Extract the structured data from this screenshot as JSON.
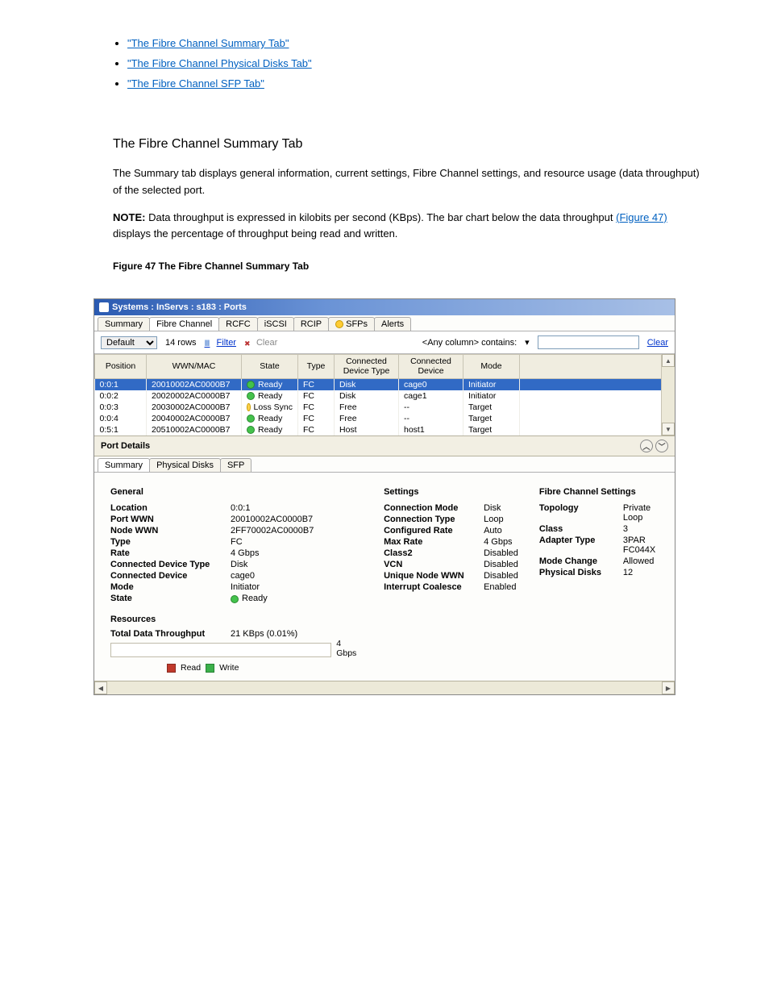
{
  "doc": {
    "links": [
      "\"The Fibre Channel Summary Tab\"",
      "\"The Fibre Channel Physical Disks Tab\"",
      "\"The Fibre Channel SFP Tab\""
    ],
    "heading1": "The Fibre Channel Summary Tab",
    "para1": "The Summary tab displays general information, current settings, Fibre Channel settings, and resource usage (data throughput) of the selected port.",
    "note_label": "NOTE:",
    "note_text": " Data throughput is expressed in kilobits per second (KBps). The bar chart below the data throughput ",
    "figref": "(Figure 47)",
    "note_tail": " displays the percentage of throughput being read and written.",
    "heading2": "Figure 47 The Fibre Channel Summary Tab"
  },
  "window": {
    "title": "Systems : InServs : s183 : Ports"
  },
  "main_tabs": [
    "Summary",
    "Fibre Channel",
    "RCFC",
    "iSCSI",
    "RCIP",
    "SFPs",
    "Alerts"
  ],
  "main_tab_active": 1,
  "sfps_has_icon": true,
  "filter": {
    "default_label": "Default",
    "rows_label": "14 rows",
    "filter_label": "Filter",
    "clear_label": "Clear",
    "contains_label": "<Any column> contains:",
    "right_clear": "Clear",
    "value": ""
  },
  "columns": [
    "Position",
    "WWN/MAC",
    "State",
    "Type",
    "Connected Device Type",
    "Connected Device",
    "Mode",
    ""
  ],
  "rows": [
    {
      "pos": "0:0:1",
      "wwn": "20010002AC0000B7",
      "state": "Ready",
      "led": "green",
      "type": "FC",
      "cdt": "Disk",
      "cd": "cage0",
      "mode": "Initiator",
      "sel": true
    },
    {
      "pos": "0:0:2",
      "wwn": "20020002AC0000B7",
      "state": "Ready",
      "led": "green",
      "type": "FC",
      "cdt": "Disk",
      "cd": "cage1",
      "mode": "Initiator",
      "sel": false
    },
    {
      "pos": "0:0:3",
      "wwn": "20030002AC0000B7",
      "state": "Loss Sync",
      "led": "yellow",
      "type": "FC",
      "cdt": "Free",
      "cd": "--",
      "mode": "Target",
      "sel": false
    },
    {
      "pos": "0:0:4",
      "wwn": "20040002AC0000B7",
      "state": "Ready",
      "led": "green",
      "type": "FC",
      "cdt": "Free",
      "cd": "--",
      "mode": "Target",
      "sel": false
    },
    {
      "pos": "0:5:1",
      "wwn": "20510002AC0000B7",
      "state": "Ready",
      "led": "green",
      "type": "FC",
      "cdt": "Host",
      "cd": "host1",
      "mode": "Target",
      "sel": false
    }
  ],
  "port_details": {
    "title": "Port Details",
    "tabs": [
      "Summary",
      "Physical Disks",
      "SFP"
    ],
    "active_tab": 0
  },
  "general": {
    "heading": "General",
    "items": {
      "Location": "0:0:1",
      "Port WWN": "20010002AC0000B7",
      "Node WWN": "2FF70002AC0000B7",
      "Type": "FC",
      "Rate": "4 Gbps",
      "Connected Device Type": "Disk",
      "Connected Device": "cage0",
      "Mode": "Initiator",
      "State": "Ready",
      "StateLed": "green"
    }
  },
  "settings": {
    "heading": "Settings",
    "items": {
      "Connection Mode": "Disk",
      "Connection Type": "Loop",
      "Configured Rate": "Auto",
      "Max Rate": "4 Gbps",
      "Class2": "Disabled",
      "VCN": "Disabled",
      "Unique Node WWN": "Disabled",
      "Interrupt Coalesce": "Enabled"
    }
  },
  "fc_settings": {
    "heading": "Fibre Channel Settings",
    "items": {
      "Topology": "Private Loop",
      "Class": "3",
      "Adapter Type": "3PAR FC044X",
      "Mode Change": "Allowed",
      "Physical Disks": "12"
    }
  },
  "resources": {
    "heading": "Resources",
    "tdt_label": "Total Data Throughput",
    "tdt_value": "21 KBps (0.01%)",
    "rate_label": "4 Gbps",
    "read_label": "Read",
    "write_label": "Write"
  }
}
